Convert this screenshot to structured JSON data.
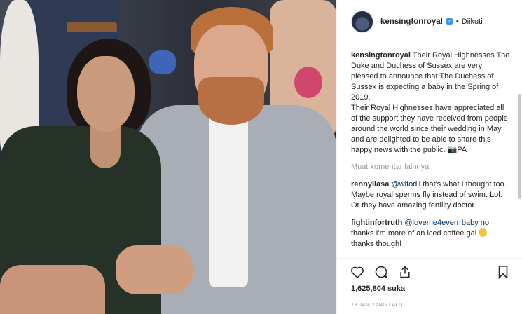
{
  "header": {
    "username": "kensingtonroyal",
    "separator": "•",
    "follow_status": "Diikuti"
  },
  "caption": {
    "username": "kensingtonroyal",
    "text": "Their Royal Highnesses The Duke and Duchess of Sussex are very pleased to announce that The Duchess of Sussex is expecting a baby in the Spring of 2019.",
    "text2": "Their Royal Highnesses have appreciated all of the support they have received from people around the world since their wedding in May and are delighted to be able to share this happy news with the public. 📷PA"
  },
  "load_more": "Muat komentar lainnya",
  "comments": [
    {
      "username": "rennyllasa",
      "mention": "@wifodil",
      "text": " that's what I thought too. Maybe royal sperms fly instead of swim. Lol. Or they have amazing fertility doctor."
    },
    {
      "username": "fightinfortruth",
      "mention": "@loveme4everrrbaby",
      "text": " no thanks I'm more of an iced coffee gal ",
      "suffix": "thanks though!"
    }
  ],
  "likes": "1,625,804 suka",
  "timestamp": "18 JAM YANG LALU",
  "icons": [
    "heart-icon",
    "comment-icon",
    "share-icon",
    "bookmark-icon",
    "verified-icon"
  ],
  "colors": {
    "verified": "#3897f0",
    "mention": "#003569",
    "muted": "#999999"
  }
}
